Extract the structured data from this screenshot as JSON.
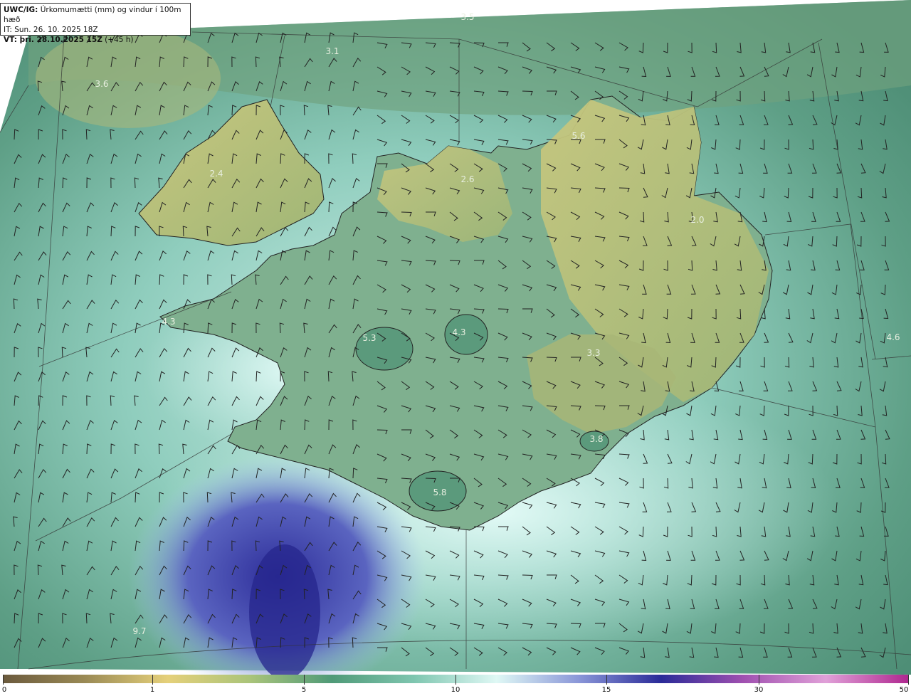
{
  "legend": {
    "line1_bold": "UWC/IG:",
    "line1_rest": "Úrkomumætti (mm) og vindur í 100m hæð",
    "line2": "IT: Sun. 26. 10. 2025 18Z",
    "line3_bold": "VT: þri. 28.10.2025 15Z",
    "line3_rest": "(+45 h)"
  },
  "map_labels": [
    "3.5",
    "3.1",
    "3.6",
    "5.6",
    "2.4",
    "2.6",
    "2.0",
    "4.3",
    "5.3",
    "4.3",
    "3.3",
    "4.6",
    "3.8",
    "5.8",
    "9.7"
  ],
  "colorbar": {
    "ticks": [
      "0",
      "1",
      "5",
      "10",
      "15",
      "30",
      "50"
    ],
    "colors": [
      "#6b5a3d",
      "#9a8a55",
      "#e5d07a",
      "#aac47a",
      "#4f9a78",
      "#7fc6b0",
      "#dff8f5",
      "#8a96d8",
      "#2a2a98",
      "#a050b0",
      "#e0a0d8",
      "#b02890"
    ]
  },
  "colors": {
    "ocean_green": "#4e937c",
    "land_yellow": "#b9c07c",
    "light_cyan": "#d6f3ee",
    "deep_blue": "#3a3aa0"
  }
}
